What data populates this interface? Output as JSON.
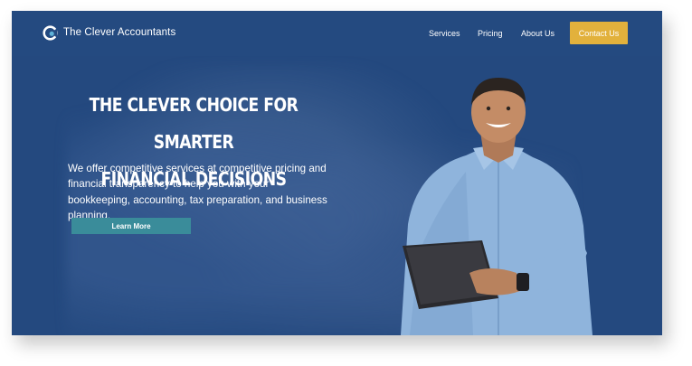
{
  "nav": {
    "brand": "The Clever Accountants",
    "links": [
      "Services",
      "Pricing",
      "About Us"
    ],
    "cta": "Contact Us"
  },
  "hero": {
    "headline_line1": "THE CLEVER CHOICE FOR SMARTER",
    "headline_line2": "FINANCIAL DECISIONS",
    "paragraph": "We offer competitive services at competitive pricing and financial transparency to help you with your bookkeeping, accounting, tax preparation, and business planning.",
    "button": "Learn More"
  },
  "colors": {
    "background": "#24497f",
    "accent": "#e2b13c",
    "button": "#3a8c9a"
  },
  "icons": {
    "logo": "c-logo-icon"
  }
}
